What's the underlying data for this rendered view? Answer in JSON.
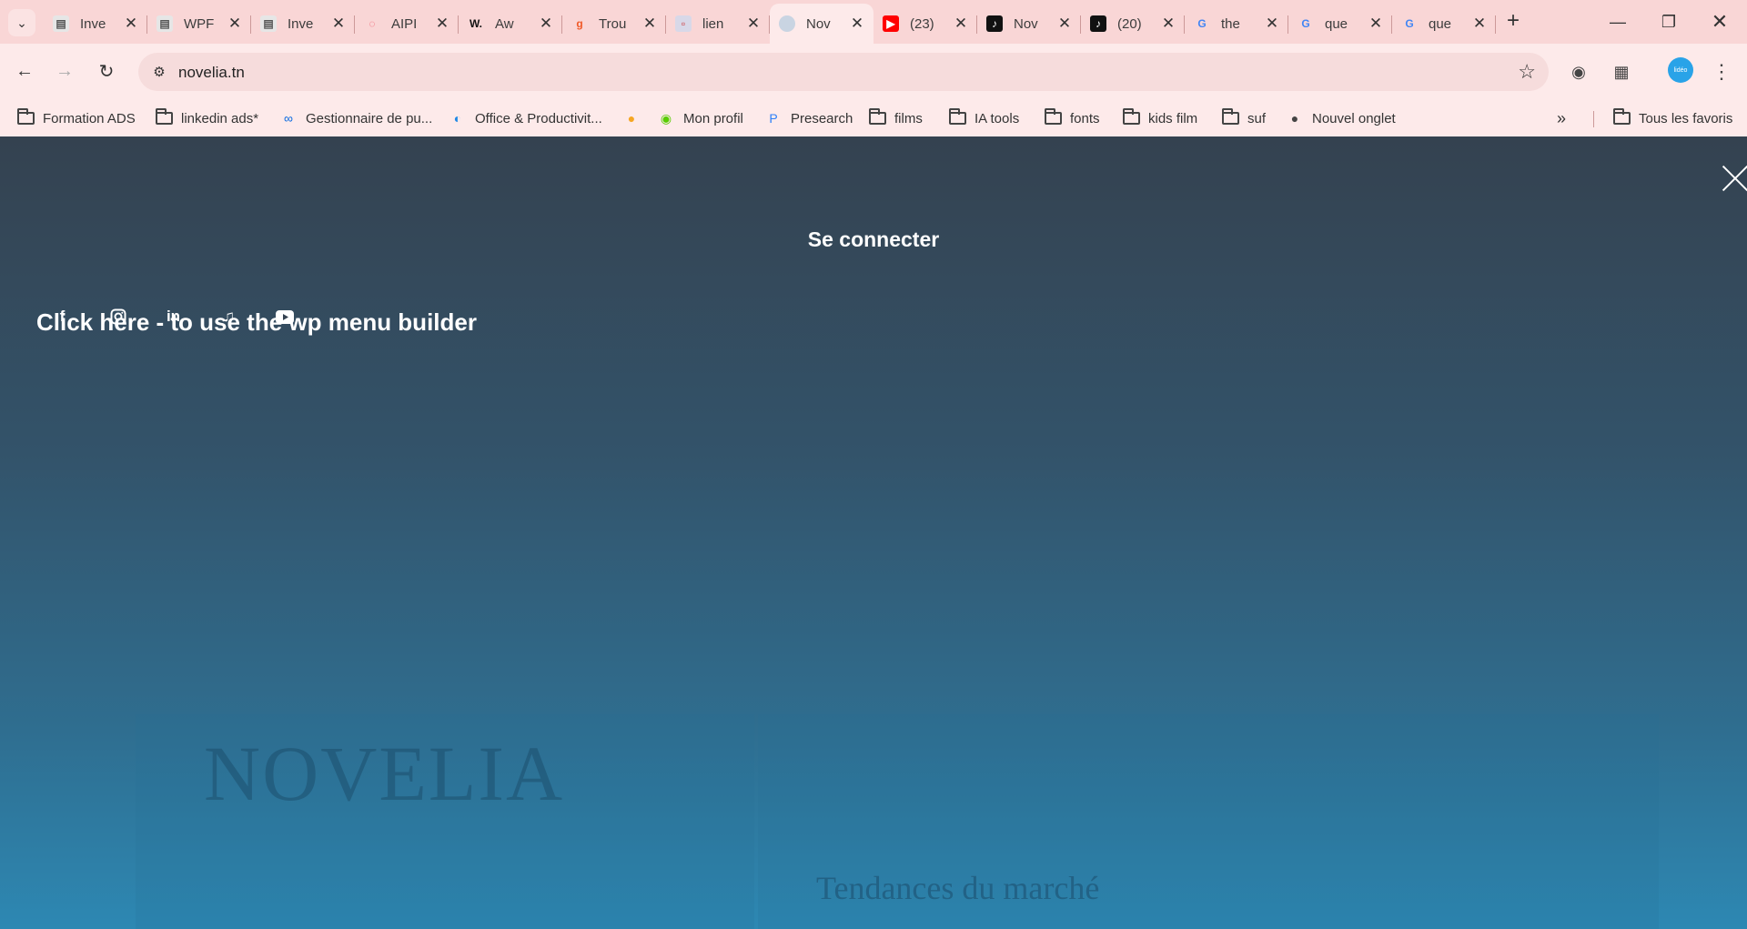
{
  "browser": {
    "tabs": [
      {
        "title": "Inve",
        "icon": "doc-icon"
      },
      {
        "title": "WPF",
        "icon": "doc-icon"
      },
      {
        "title": "Inve",
        "icon": "doc-icon"
      },
      {
        "title": "AIPI",
        "icon": "rainbow-icon"
      },
      {
        "title": "Aw",
        "icon": "w-icon"
      },
      {
        "title": "Trou",
        "icon": "g-orange-icon"
      },
      {
        "title": "lien",
        "icon": "page-icon"
      },
      {
        "title": "Nov",
        "icon": "globe-icon",
        "active": true
      },
      {
        "title": "(23)",
        "icon": "youtube-icon"
      },
      {
        "title": "Nov",
        "icon": "tiktok-icon"
      },
      {
        "title": "(20)",
        "icon": "tiktok-icon"
      },
      {
        "title": "the",
        "icon": "google-icon"
      },
      {
        "title": "que",
        "icon": "google-icon"
      },
      {
        "title": "que",
        "icon": "google-icon"
      }
    ],
    "url": "novelia.tn",
    "bookmarks": [
      {
        "label": "Formation ADS",
        "icon": "folder"
      },
      {
        "label": "linkedin ads*",
        "icon": "folder"
      },
      {
        "label": "Gestionnaire de pu...",
        "icon": "meta-icon"
      },
      {
        "label": "Office & Productivit...",
        "icon": "office-icon"
      },
      {
        "label": "",
        "icon": "k-icon"
      },
      {
        "label": "Mon profil",
        "icon": "owl-icon"
      },
      {
        "label": "Presearch",
        "icon": "presearch-icon"
      },
      {
        "label": "films",
        "icon": "folder"
      },
      {
        "label": "IA tools",
        "icon": "folder"
      },
      {
        "label": "fonts",
        "icon": "folder"
      },
      {
        "label": "kids film",
        "icon": "folder"
      },
      {
        "label": "suf",
        "icon": "folder"
      },
      {
        "label": "Nouvel onglet",
        "icon": "globe-icon"
      }
    ],
    "all_bookmarks": "Tous les favoris",
    "profile_text": "lidéo"
  },
  "page": {
    "login_label": "Se connecter",
    "menu_builder_text": "Click here - to use the wp menu builder",
    "background_logo": "NOVELIA",
    "background_heading": "Tendances du marché"
  }
}
